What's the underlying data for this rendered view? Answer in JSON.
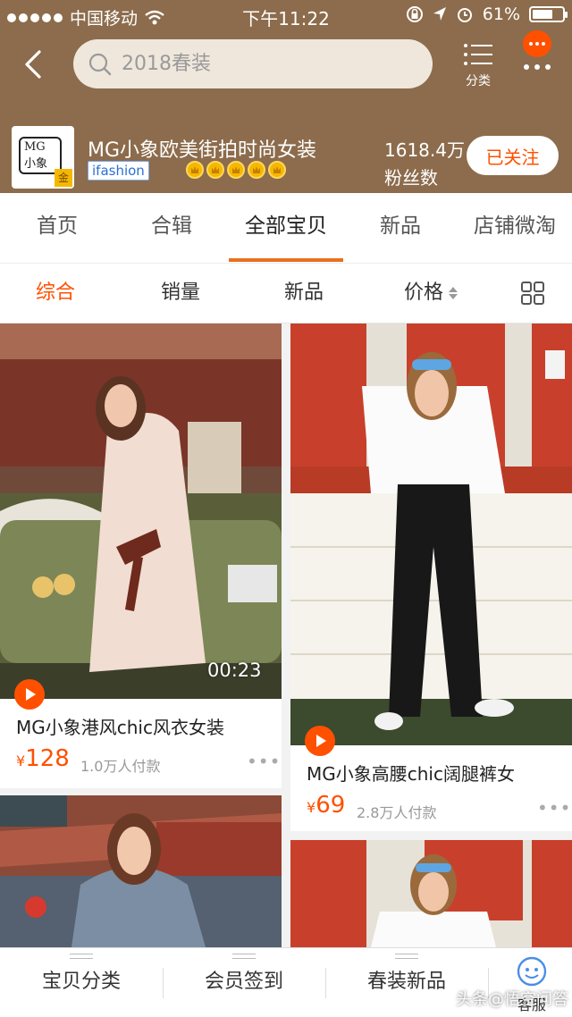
{
  "status_bar": {
    "carrier": "中国移动",
    "time": "下午11:22",
    "battery": "61%"
  },
  "search": {
    "placeholder": "2018春装"
  },
  "header": {
    "category_label": "分类"
  },
  "store": {
    "logo_text": "MG 小象",
    "name": "MG小象欧美街拍时尚女装",
    "tag": "ifashion",
    "crowns": 5,
    "fans_count": "1618.4万",
    "fans_label": "粉丝数",
    "follow_label": "已关注"
  },
  "tabs": [
    "首页",
    "合辑",
    "全部宝贝",
    "新品",
    "店铺微淘"
  ],
  "sort": [
    "综合",
    "销量",
    "新品",
    "价格"
  ],
  "products": [
    {
      "title": "MG小象港风chic风衣女装",
      "currency": "¥",
      "price": "128",
      "sold": "1.0万人付款",
      "duration": "00:23"
    },
    {
      "title": "MG小象高腰chic阔腿裤女",
      "currency": "¥",
      "price": "69",
      "sold": "2.8万人付款"
    }
  ],
  "bottom_bar": {
    "items": [
      "宝贝分类",
      "会员签到",
      "春装新品"
    ],
    "service_label": "客服"
  },
  "watermark": "头条@悟空问答",
  "colors": {
    "header_bg": "#8c6c4c",
    "accent": "#ff5000",
    "tab_underline": "#e8701f"
  }
}
